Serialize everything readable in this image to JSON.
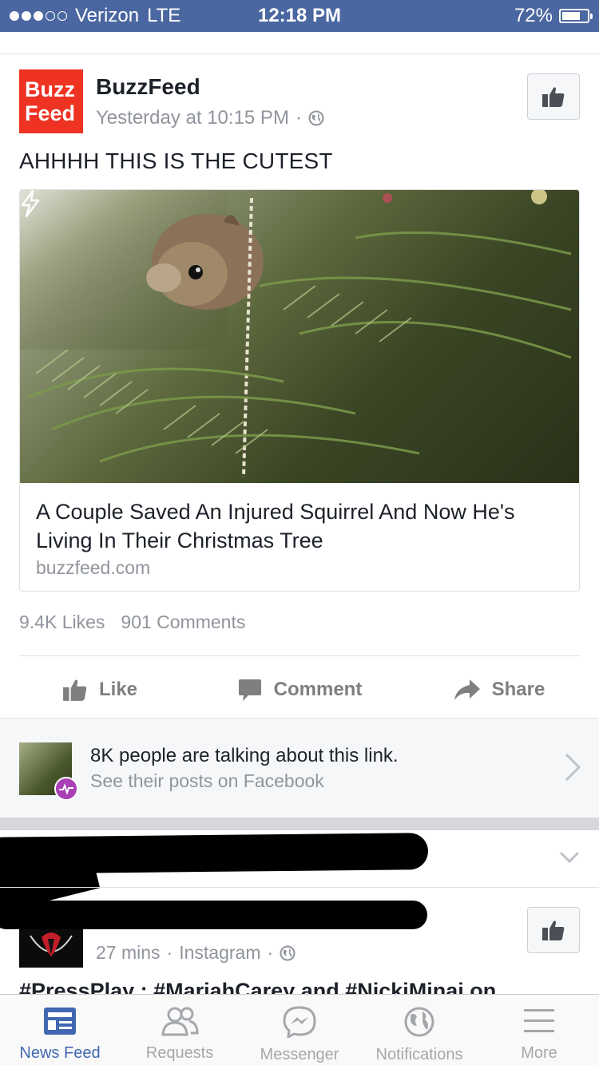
{
  "status_bar": {
    "carrier": "Verizon",
    "network": "LTE",
    "time": "12:18 PM",
    "battery": "72%",
    "battery_level": 0.72,
    "signal_bars_filled": 3,
    "signal_bars_total": 5
  },
  "post": {
    "avatar_text_line1": "Buzz",
    "avatar_text_line2": "Feed",
    "page_name": "BuzzFeed",
    "timestamp": "Yesterday at 10:15 PM",
    "separator": "·",
    "text": "AHHHH THIS IS THE CUTEST",
    "link": {
      "title": "A Couple Saved An Injured Squirrel And Now He's Living In Their Christmas Tree",
      "domain": "buzzfeed.com"
    },
    "likes": "9.4K Likes",
    "comments": "901 Comments",
    "actions": {
      "like": "Like",
      "comment": "Comment",
      "share": "Share"
    }
  },
  "talking": {
    "title": "8K people are talking about this link.",
    "subtitle": "See their posts on Facebook"
  },
  "post2": {
    "timestamp": "27 mins",
    "separator": "·",
    "source": "Instagram",
    "text": "#PressPlay : #MariahCarey and #NickiMinaj on"
  },
  "tabs": [
    {
      "label": "News Feed",
      "icon": "news-feed-icon",
      "active": true
    },
    {
      "label": "Requests",
      "icon": "requests-icon",
      "active": false
    },
    {
      "label": "Messenger",
      "icon": "messenger-icon",
      "active": false
    },
    {
      "label": "Notifications",
      "icon": "notifications-globe-icon",
      "active": false
    },
    {
      "label": "More",
      "icon": "more-menu-icon",
      "active": false
    }
  ],
  "colors": {
    "status_bar": "#4b67a1",
    "brand_blue": "#4267b2",
    "buzzfeed_red": "#ee3322",
    "trending_badge": "#a93fb5"
  }
}
